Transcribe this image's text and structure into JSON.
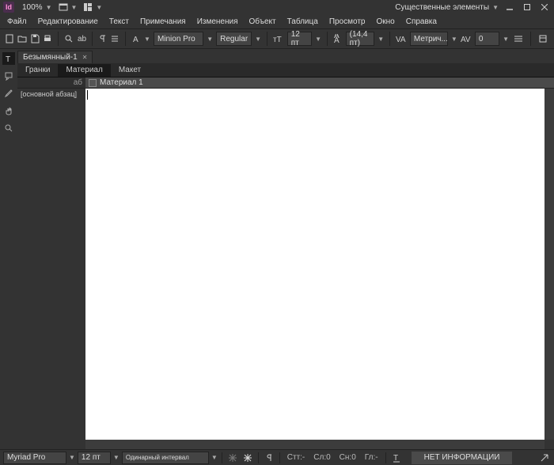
{
  "titlebar": {
    "app_logo_text": "Id",
    "zoom": "100%",
    "workspace_label": "Существенные элементы"
  },
  "menu": {
    "items": [
      "Файл",
      "Редактирование",
      "Текст",
      "Примечания",
      "Изменения",
      "Объект",
      "Таблица",
      "Просмотр",
      "Окно",
      "Справка"
    ]
  },
  "controlbar": {
    "font_family": "Minion Pro",
    "font_style": "Regular",
    "font_size": "12 пт",
    "leading": "(14,4 пт)",
    "kerning": "Метрич...",
    "tracking": "0"
  },
  "document": {
    "tab_name": "Безымянный-1",
    "subtabs": [
      "Гранки",
      "Материал",
      "Макет"
    ],
    "active_subtab": 1
  },
  "side_panel": {
    "header_hint": "аб",
    "items": [
      "[основной абзац]"
    ]
  },
  "material": {
    "header": "Материал 1"
  },
  "statusbar": {
    "font_family": "Myriad Pro",
    "font_size": "12 пт",
    "leading": "Одинарный интервал",
    "labels": {
      "page": "Стт:-",
      "col": "Сл:0",
      "line": "Сн:0",
      "pos": "Гл:-"
    },
    "info": "НЕТ ИНФОРМАЦИИ"
  }
}
